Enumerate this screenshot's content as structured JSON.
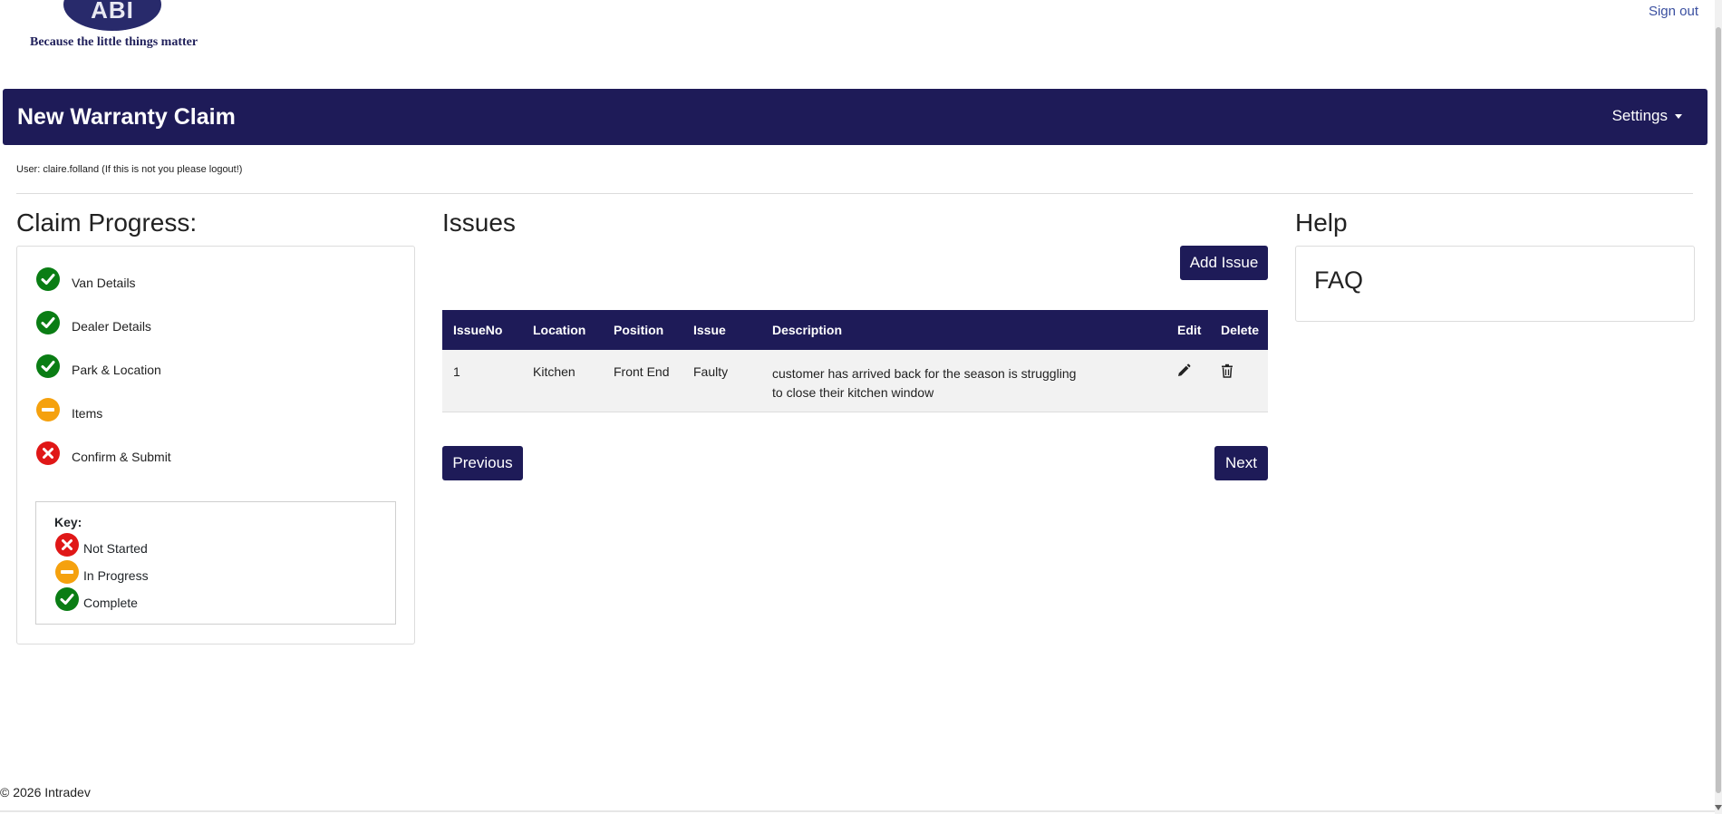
{
  "brand": {
    "logo_text": "ABI",
    "tagline": "Because the little things matter"
  },
  "header": {
    "sign_out": "Sign out",
    "title": "New Warranty Claim",
    "settings": "Settings"
  },
  "user_line": "User: claire.folland (If this is not you please logout!)",
  "progress": {
    "heading": "Claim Progress:",
    "steps": [
      {
        "label": "Van Details",
        "status": "complete"
      },
      {
        "label": "Dealer Details",
        "status": "complete"
      },
      {
        "label": "Park & Location",
        "status": "complete"
      },
      {
        "label": "Items",
        "status": "in-progress"
      },
      {
        "label": "Confirm & Submit",
        "status": "not-started"
      }
    ],
    "key": {
      "title": "Key:",
      "not_started": "Not Started",
      "in_progress": "In Progress",
      "complete": "Complete"
    }
  },
  "issues": {
    "heading": "Issues",
    "add_button": "Add Issue",
    "columns": [
      "IssueNo",
      "Location",
      "Position",
      "Issue",
      "Description",
      "Edit",
      "Delete"
    ],
    "rows": [
      {
        "issue_no": "1",
        "location": "Kitchen",
        "position": "Front End",
        "issue": "Faulty",
        "description": "customer has arrived back for the season is struggling to close their kitchen window"
      }
    ],
    "previous_button": "Previous",
    "next_button": "Next"
  },
  "help": {
    "heading": "Help",
    "faq": "FAQ"
  },
  "footer": "© 2026 Intradev",
  "colors": {
    "primary": "#1e1b58",
    "complete": "#0a7d14",
    "in_progress": "#f5a10e",
    "not_started": "#e01717",
    "link": "#3a4fa0"
  }
}
